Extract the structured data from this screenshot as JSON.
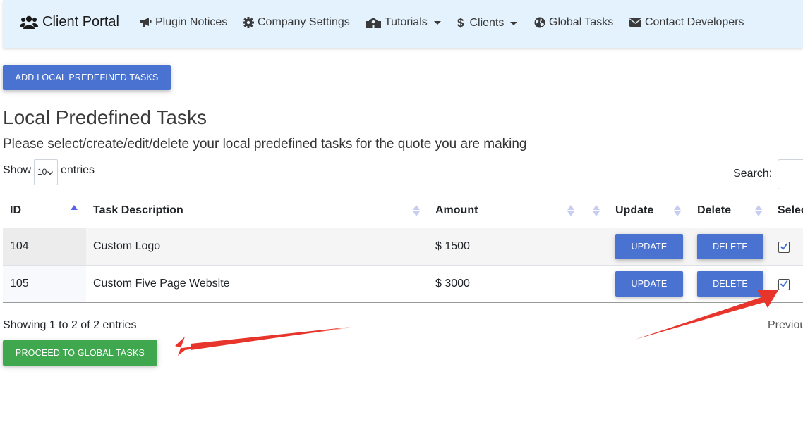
{
  "navbar": {
    "brand": "Client Portal",
    "items": [
      {
        "label": "Plugin Notices",
        "icon": "bullhorn-icon"
      },
      {
        "label": "Company Settings",
        "icon": "gear-icon"
      },
      {
        "label": "Tutorials",
        "icon": "school-icon",
        "dropdown": true
      },
      {
        "label": "Clients",
        "icon": "dollar-icon",
        "dropdown": true
      },
      {
        "label": "Global Tasks",
        "icon": "globe-icon"
      },
      {
        "label": "Contact Developers",
        "icon": "envelope-icon"
      }
    ]
  },
  "add_button": "ADD LOCAL PREDEFINED TASKS",
  "page_title": "Local Predefined Tasks",
  "page_subtitle": "Please select/create/edit/delete your local predefined tasks for the quote you are making",
  "length": {
    "show_label": "Show",
    "selected": "10",
    "entries_label": "entries"
  },
  "search_label": "Search:",
  "table": {
    "headers": [
      "ID",
      "Task Description",
      "Amount",
      "Update",
      "Delete",
      "Select"
    ],
    "rows": [
      {
        "id": "104",
        "description": "Custom Logo",
        "amount": "$ 1500",
        "update": "UPDATE",
        "delete": "DELETE",
        "selected": true
      },
      {
        "id": "105",
        "description": "Custom Five Page Website",
        "amount": "$ 3000",
        "update": "UPDATE",
        "delete": "DELETE",
        "selected": true
      }
    ]
  },
  "info_text": "Showing 1 to 2 of 2 entries",
  "prev_label": "Previous",
  "proceed_button": "PROCEED TO GLOBAL TASKS",
  "colors": {
    "navbar_bg": "#e3f2fd",
    "primary": "#4a72d0",
    "success": "#3fa84e",
    "annotation_arrow": "#e8352b"
  }
}
